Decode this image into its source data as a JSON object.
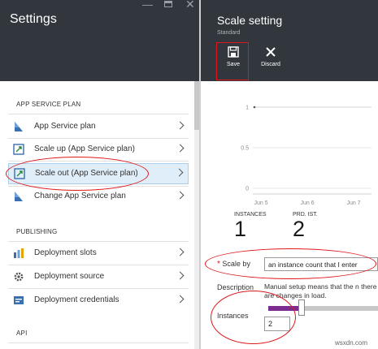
{
  "settings": {
    "title": "Settings",
    "sections": [
      {
        "label": "APP SERVICE PLAN",
        "items": [
          {
            "label": "App Service plan",
            "icon": "app-service-plan-icon"
          },
          {
            "label": "Scale up (App Service plan)",
            "icon": "scale-up-icon"
          },
          {
            "label": "Scale out (App Service plan)",
            "icon": "scale-out-icon",
            "selected": true
          },
          {
            "label": "Change App Service plan",
            "icon": "change-plan-icon"
          }
        ]
      },
      {
        "label": "PUBLISHING",
        "items": [
          {
            "label": "Deployment slots",
            "icon": "deployment-slots-icon"
          },
          {
            "label": "Deployment source",
            "icon": "gear-icon"
          },
          {
            "label": "Deployment credentials",
            "icon": "credentials-icon"
          }
        ]
      },
      {
        "label": "API",
        "items": []
      }
    ]
  },
  "scale_setting": {
    "title": "Scale setting",
    "subtitle": "Standard",
    "commands": {
      "save": "Save",
      "discard": "Discard"
    },
    "stats": [
      {
        "label": "INSTANCES",
        "value": "1"
      },
      {
        "label": "PRD. IST.",
        "value": "2"
      }
    ],
    "scale_by": {
      "label": "Scale by",
      "value": "an instance count that I enter"
    },
    "description": {
      "label": "Description",
      "text": "Manual setup means that the n there are changes in load."
    },
    "instances": {
      "label": "Instances",
      "value": "2",
      "slider_fraction": 0.3
    }
  },
  "chart_data": {
    "type": "line",
    "x": [
      "Jun 5",
      "Jun 6",
      "Jun 7"
    ],
    "yticks": [
      "1",
      "0.5",
      "0"
    ],
    "ylim": [
      0,
      1
    ],
    "series": [
      {
        "values": [
          1,
          1,
          1
        ]
      }
    ]
  },
  "watermark": "wsxdn.com",
  "colors": {
    "header": "#32373d",
    "accent": "#7b2c8e",
    "selected": "#e0eef9",
    "annotation": "#e0161b"
  }
}
